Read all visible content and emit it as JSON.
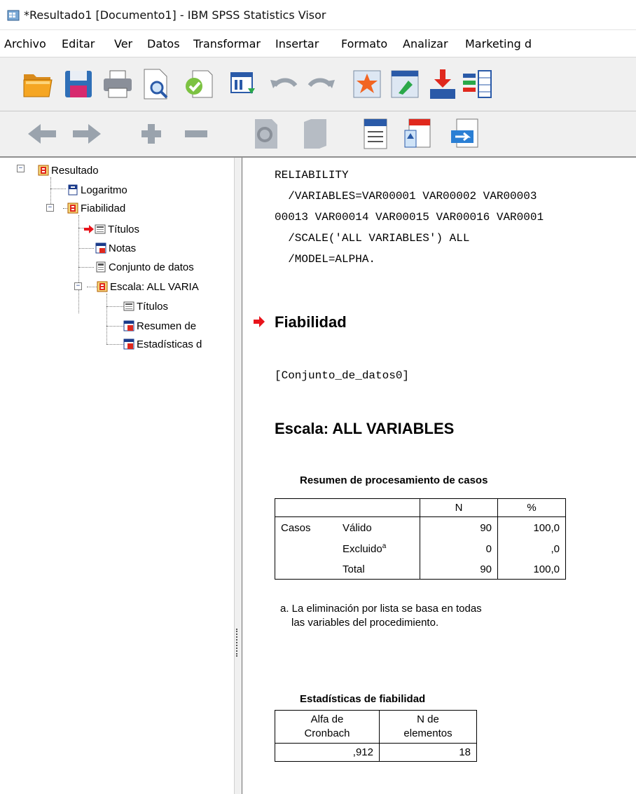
{
  "window": {
    "title": "*Resultado1 [Documento1] - IBM SPSS Statistics Visor"
  },
  "menu": [
    {
      "label": "Archivo"
    },
    {
      "label": "Editar"
    },
    {
      "label": "Ver"
    },
    {
      "label": "Datos"
    },
    {
      "label": "Transformar"
    },
    {
      "label": "Insertar"
    },
    {
      "label": "Formato"
    },
    {
      "label": "Analizar"
    },
    {
      "label": "Marketing d"
    }
  ],
  "toolbar1": [
    "open-folder-icon",
    "save-icon",
    "print-icon",
    "print-preview-icon",
    "export-icon",
    "recall-dialog-icon",
    "undo-icon",
    "redo-icon",
    "goto-case-icon",
    "goto-variable-icon",
    "insert-output-icon",
    "variables-icon"
  ],
  "toolbar2": [
    "back-arrow-icon",
    "forward-arrow-icon",
    "expand-plus-icon",
    "collapse-minus-icon",
    "show-icon",
    "hide-icon",
    "insert-heading-icon",
    "insert-title-icon",
    "insert-text-icon"
  ],
  "nav_tree": {
    "items": [
      {
        "label": "Resultado"
      },
      {
        "label": "Logaritmo"
      },
      {
        "label": "Fiabilidad"
      },
      {
        "label": "Títulos"
      },
      {
        "label": "Notas"
      },
      {
        "label": "Conjunto de datos"
      },
      {
        "label": "Escala: ALL VARIA"
      },
      {
        "label": "Títulos"
      },
      {
        "label": "Resumen de"
      },
      {
        "label": "Estadísticas d"
      }
    ]
  },
  "output": {
    "syntax": [
      "RELIABILITY",
      "  /VARIABLES=VAR00001 VAR00002 VAR00003",
      "00013 VAR00014 VAR00015 VAR00016 VAR0001",
      "  /SCALE('ALL VARIABLES') ALL",
      "  /MODEL=ALPHA."
    ],
    "heading": "Fiabilidad",
    "dataset": "[Conjunto_de_datos0]",
    "scale_heading": "Escala: ALL VARIABLES",
    "case_summary": {
      "caption": "Resumen de procesamiento de casos",
      "col_n": "N",
      "col_pct": "%",
      "row_group": "Casos",
      "rows": [
        {
          "label": "Válido",
          "sup": "",
          "n": "90",
          "pct": "100,0"
        },
        {
          "label": "Excluido",
          "sup": "a",
          "n": "0",
          "pct": ",0"
        },
        {
          "label": "Total",
          "sup": "",
          "n": "90",
          "pct": "100,0"
        }
      ],
      "footnote_1": "a. La eliminación por lista se basa en todas",
      "footnote_2": "las variables del procedimiento."
    },
    "reliability": {
      "caption": "Estadísticas de fiabilidad",
      "col1_a": "Alfa de",
      "col1_b": "Cronbach",
      "col2_a": "N de",
      "col2_b": "elementos",
      "alpha": ",912",
      "n_items": "18"
    }
  },
  "colors": {
    "arrow_red": "#e8141b",
    "tree_line": "#777777"
  }
}
